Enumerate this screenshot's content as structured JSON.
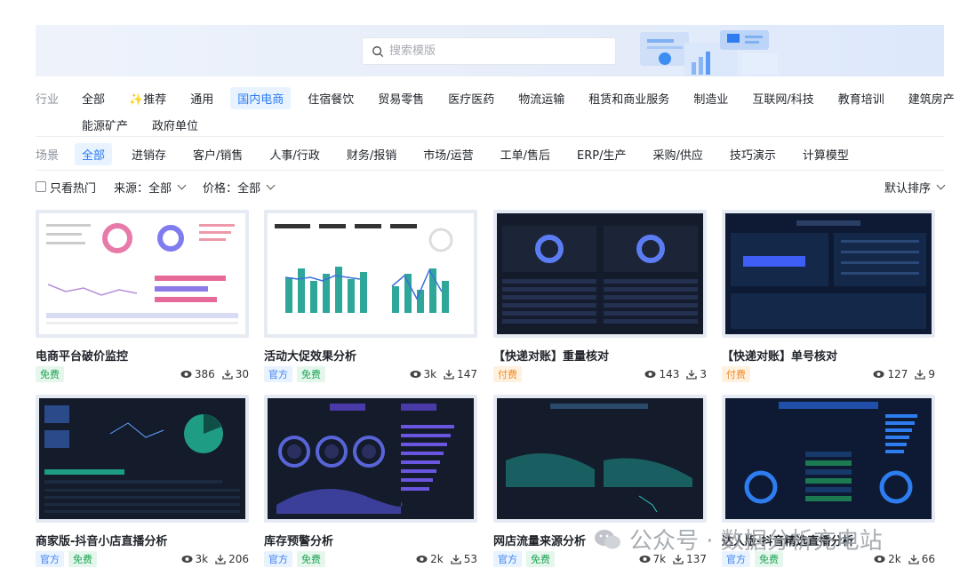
{
  "search": {
    "placeholder": "搜索模版"
  },
  "industry": {
    "label": "行业",
    "items": [
      "全部",
      "✨推荐",
      "通用",
      "国内电商",
      "住宿餐饮",
      "贸易零售",
      "医疗医药",
      "物流运输",
      "租赁和商业服务",
      "制造业",
      "互联网/科技",
      "教育培训",
      "建筑房产"
    ],
    "items_row2": [
      "能源矿产",
      "政府单位"
    ],
    "active": "国内电商"
  },
  "scene": {
    "label": "场景",
    "items": [
      "全部",
      "进销存",
      "客户/销售",
      "人事/行政",
      "财务/报销",
      "市场/运营",
      "工单/售后",
      "ERP/生产",
      "采购/供应",
      "技巧演示",
      "计算模型"
    ],
    "active": "全部"
  },
  "options": {
    "hot_only": "只看热门",
    "source_label": "来源：",
    "source_value": "全部",
    "price_label": "价格：",
    "price_value": "全部",
    "sort": "默认排序"
  },
  "cards": [
    {
      "title": "电商平台破价监控",
      "tags": [
        {
          "text": "免费",
          "kind": "free"
        }
      ],
      "views": "386",
      "downloads": "30",
      "theme": "light1"
    },
    {
      "title": "活动大促效果分析",
      "tags": [
        {
          "text": "官方",
          "kind": "official"
        },
        {
          "text": "免费",
          "kind": "free"
        }
      ],
      "views": "3k",
      "downloads": "147",
      "theme": "light2"
    },
    {
      "title": "【快递对账】重量核对",
      "tags": [
        {
          "text": "付费",
          "kind": "paid"
        }
      ],
      "views": "143",
      "downloads": "3",
      "theme": "dark1"
    },
    {
      "title": "【快递对账】单号核对",
      "tags": [
        {
          "text": "付费",
          "kind": "paid"
        }
      ],
      "views": "127",
      "downloads": "9",
      "theme": "dark2"
    },
    {
      "title": "商家版-抖音小店直播分析",
      "tags": [
        {
          "text": "官方",
          "kind": "official"
        },
        {
          "text": "免费",
          "kind": "free"
        }
      ],
      "views": "3k",
      "downloads": "206",
      "theme": "dark3"
    },
    {
      "title": "库存预警分析",
      "tags": [
        {
          "text": "官方",
          "kind": "official"
        },
        {
          "text": "免费",
          "kind": "free"
        }
      ],
      "views": "2k",
      "downloads": "53",
      "theme": "dark4"
    },
    {
      "title": "网店流量来源分析",
      "tags": [
        {
          "text": "官方",
          "kind": "official"
        },
        {
          "text": "免费",
          "kind": "free"
        }
      ],
      "views": "7k",
      "downloads": "137",
      "theme": "dark5"
    },
    {
      "title": "达人版-抖音精选直播分析",
      "tags": [
        {
          "text": "官方",
          "kind": "official"
        },
        {
          "text": "免费",
          "kind": "free"
        }
      ],
      "views": "2k",
      "downloads": "66",
      "theme": "dark6"
    }
  ],
  "watermark": {
    "text": "公众号 · 数据分析充电站"
  },
  "colors": {
    "accent": "#2a7bf2",
    "free": "#1da354",
    "official": "#3b7ff0",
    "paid": "#f08a24"
  }
}
